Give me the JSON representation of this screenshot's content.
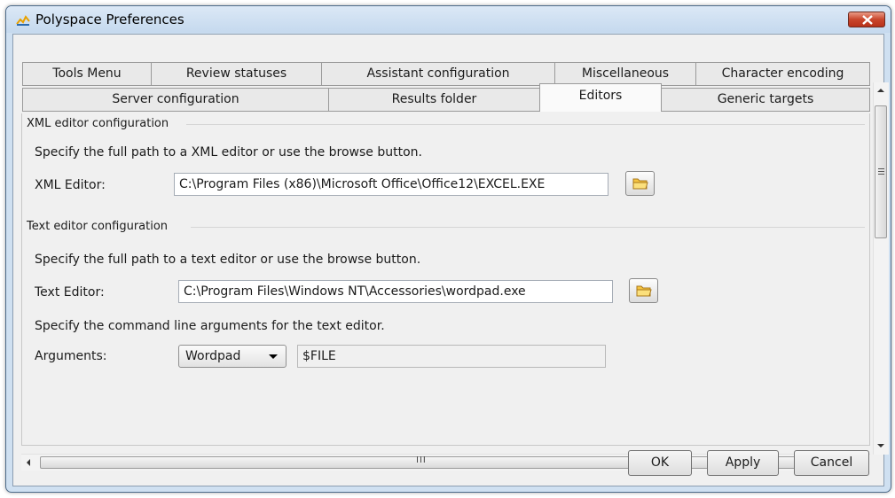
{
  "window": {
    "title": "Polyspace Preferences"
  },
  "tabs_row1": [
    {
      "label": "Tools Menu"
    },
    {
      "label": "Review statuses"
    },
    {
      "label": "Assistant configuration"
    },
    {
      "label": "Miscellaneous"
    },
    {
      "label": "Character encoding"
    }
  ],
  "tabs_row2": [
    {
      "label": "Server configuration"
    },
    {
      "label": "Results folder"
    },
    {
      "label": "Editors",
      "active": true
    },
    {
      "label": "Generic targets"
    }
  ],
  "xml_section": {
    "title": "XML editor configuration",
    "instruction": "Specify the full path to a XML editor or use the browse button.",
    "field_label": "XML Editor:",
    "field_value": "C:\\Program Files (x86)\\Microsoft Office\\Office12\\EXCEL.EXE"
  },
  "text_section": {
    "title": "Text editor configuration",
    "instruction": "Specify the full path to a text editor or use the browse button.",
    "field_label": "Text Editor:",
    "field_value": "C:\\Program Files\\Windows NT\\Accessories\\wordpad.exe",
    "args_instruction": "Specify the command line arguments for the text editor.",
    "args_label": "Arguments:",
    "args_preset": "Wordpad",
    "args_value": "$FILE"
  },
  "hscroll_center": "III",
  "buttons": {
    "ok": "OK",
    "apply": "Apply",
    "cancel": "Cancel"
  },
  "colors": {
    "title_bar": "#cfe0f1",
    "close_button": "#c9452b",
    "folder_icon": "#f5c542"
  }
}
